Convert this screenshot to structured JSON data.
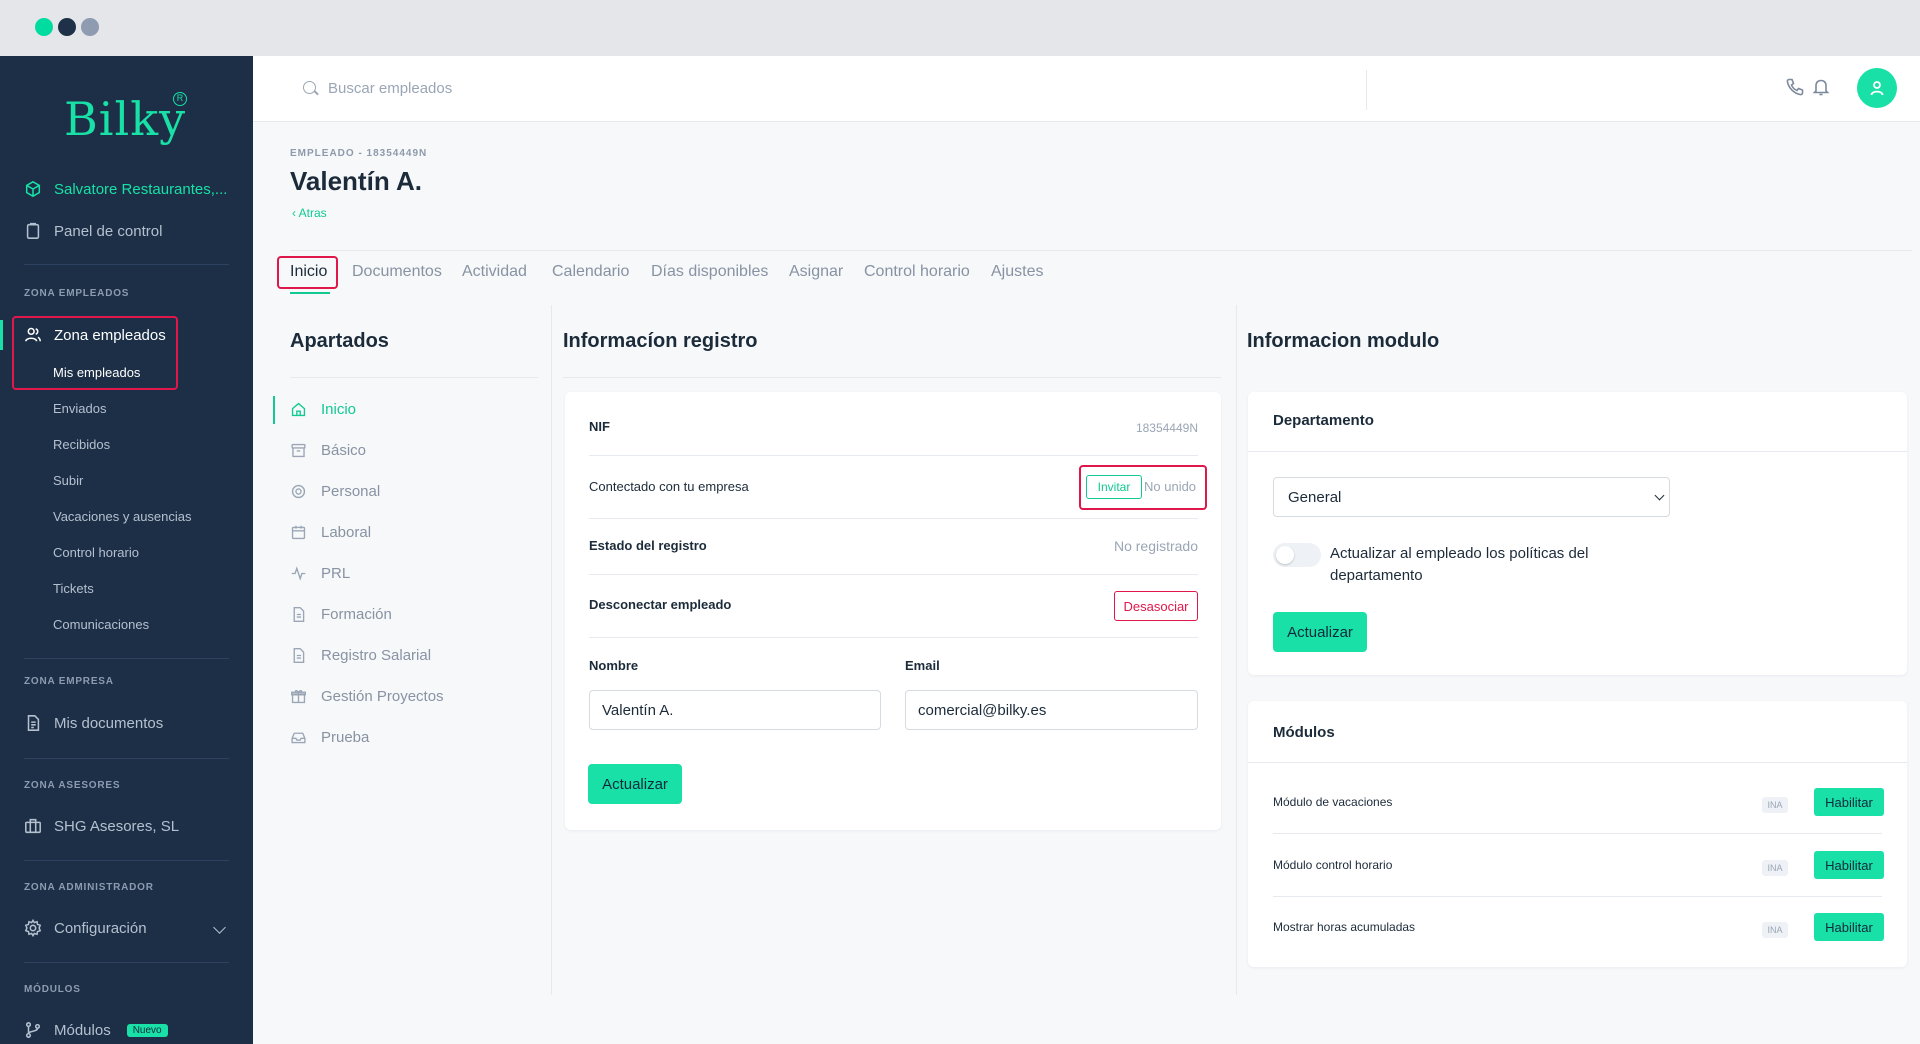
{
  "chrome": {
    "dot_colors": [
      "#00dca0",
      "#1e3148",
      "#8e9bb0"
    ]
  },
  "sidebar": {
    "logo": "Bilky",
    "logo_mark": "R",
    "company": "Salvatore Restaurantes,...",
    "panel": "Panel de control",
    "zona_empleados_title": "ZONA EMPLEADOS",
    "zona_empleados": "Zona empleados",
    "sub_items": [
      "Mis empleados",
      "Enviados",
      "Recibidos",
      "Subir",
      "Vacaciones y ausencias",
      "Control horario",
      "Tickets",
      "Comunicaciones"
    ],
    "zona_empresa_title": "ZONA EMPRESA",
    "mis_documentos": "Mis documentos",
    "zona_asesores_title": "ZONA ASESORES",
    "asesor": "SHG Asesores, SL",
    "zona_admin_title": "ZONA ADMINISTRADOR",
    "configuracion": "Configuración",
    "modulos_title": "MÓDULOS",
    "modulos": "Módulos",
    "nuevo_badge": "Nuevo"
  },
  "topbar": {
    "search_placeholder": "Buscar empleados"
  },
  "header": {
    "crumb": "EMPLEADO - 18354449N",
    "title": "Valentín A.",
    "back": "‹ Atras"
  },
  "tabs": [
    "Inicio",
    "Documentos",
    "Actividad",
    "Calendario",
    "Días disponibles",
    "Asignar",
    "Control horario",
    "Ajustes"
  ],
  "apartados": {
    "title": "Apartados",
    "items": [
      "Inicio",
      "Básico",
      "Personal",
      "Laboral",
      "PRL",
      "Formación",
      "Registro Salarial",
      "Gestión Proyectos",
      "Prueba"
    ]
  },
  "registro": {
    "title": "Informacíon registro",
    "nif_label": "NIF",
    "nif_value": "18354449N",
    "conectado_label": "Contectado con tu empresa",
    "invite_label": "Invitar",
    "no_unido": "No unido",
    "estado_label": "Estado del registro",
    "estado_value": "No registrado",
    "desconectar_label": "Desconectar empleado",
    "desasociar_label": "Desasociar",
    "nombre_label": "Nombre",
    "nombre_value": "Valentín A.",
    "email_label": "Email",
    "email_value": "comercial@bilky.es",
    "actualizar": "Actualizar"
  },
  "modulo": {
    "title": "Informacion modulo",
    "departamento_title": "Departamento",
    "departamento_value": "General",
    "toggle_label": "Actualizar al empleado los políticas del departamento",
    "toggle_on": false,
    "actualizar": "Actualizar",
    "modulos_title": "Módulos",
    "modulos": [
      {
        "label": "Módulo de vacaciones",
        "badge": "INA",
        "button": "Habilitar"
      },
      {
        "label": "Módulo control horario",
        "badge": "INA",
        "button": "Habilitar"
      },
      {
        "label": "Mostrar horas acumuladas",
        "badge": "INA",
        "button": "Habilitar"
      }
    ]
  },
  "colors": {
    "accent": "#18e0a6",
    "sidebar": "#1c2f47",
    "highlight": "#e0174b"
  }
}
